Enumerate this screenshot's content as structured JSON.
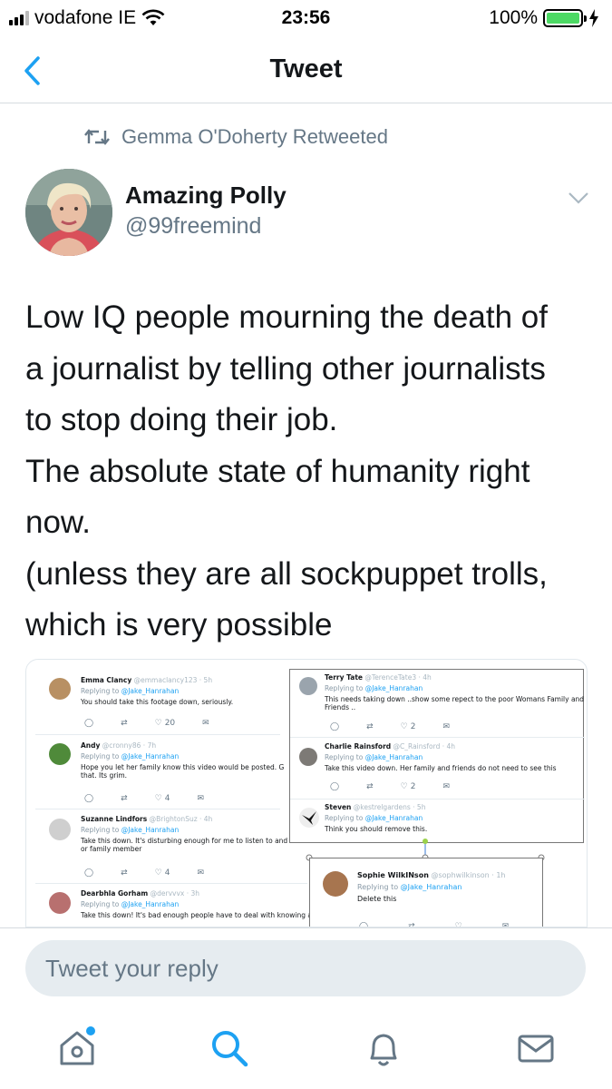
{
  "status_bar": {
    "carrier": "vodafone IE",
    "time": "23:56",
    "battery": "100%"
  },
  "nav": {
    "title": "Tweet"
  },
  "retweet": {
    "label": "Gemma O'Doherty Retweeted"
  },
  "author": {
    "name": "Amazing Polly",
    "handle": "@99freemind"
  },
  "tweet": {
    "lines": [
      "Low IQ people mourning the death of",
      "a journalist by telling other journalists",
      "to stop doing their job.",
      "The absolute state of humanity right",
      "now.",
      "(unless they are all sockpuppet trolls,",
      "which is very possible"
    ]
  },
  "media": {
    "replies": [
      {
        "name": "Emma Clancy",
        "handle": "@emmaclancy123 · 5h",
        "replying": "Replying to",
        "target": "@Jake_Hanrahan",
        "text": "You should take this footage down, seriously.",
        "likes": "20"
      },
      {
        "name": "Andy",
        "handle": "@cronny86 · 7h",
        "replying": "Replying to",
        "target": "@Jake_Hanrahan",
        "text": "Hope you let her family know this video would be posted. G",
        "text2": "that. Its grim.",
        "likes": "4"
      },
      {
        "name": "Suzanne Lindfors",
        "handle": "@BrightonSuz · 4h",
        "replying": "Replying to",
        "target": "@Jake_Hanrahan",
        "text": "Take this down. It's disturbing enough for me to listen to and I'm not her friend",
        "text2": "or family member",
        "likes": "4"
      },
      {
        "name": "Dearbhla Gorham",
        "handle": "@dervvvx · 3h",
        "replying": "Replying to",
        "target": "@Jake_Hanrahan",
        "text": "Take this down! It's bad enough people have to deal with knowing a"
      },
      {
        "name": "Terry Tate",
        "handle": "@TerenceTate3 · 4h",
        "replying": "Replying to",
        "target": "@Jake_Hanrahan",
        "text": "This needs taking down ..show some repect to the poor Womans Family and",
        "text2": "Friends ..",
        "likes": "2"
      },
      {
        "name": "Charlie Rainsford",
        "handle": "@C_Rainsford · 4h",
        "replying": "Replying to",
        "target": "@Jake_Hanrahan",
        "text": "Take this video down. Her family and friends do not need to see this",
        "likes": "2"
      },
      {
        "name": "Steven",
        "handle": "@kestrelgardens · 5h",
        "replying": "Replying to",
        "target": "@Jake_Hanrahan",
        "text": "Think you should remove this."
      },
      {
        "name": "Sophie WilkINson",
        "handle": "@sophwilkinson · 1h",
        "replying": "Replying to",
        "target": "@Jake_Hanrahan",
        "text": "Delete this"
      }
    ]
  },
  "reply_bar": {
    "placeholder": "Tweet your reply"
  },
  "tabs": [
    "home-icon",
    "search-icon",
    "bell-icon",
    "mail-icon"
  ],
  "colors": {
    "accent": "#1da1f2",
    "muted": "#657786",
    "battery": "#4cd964"
  }
}
